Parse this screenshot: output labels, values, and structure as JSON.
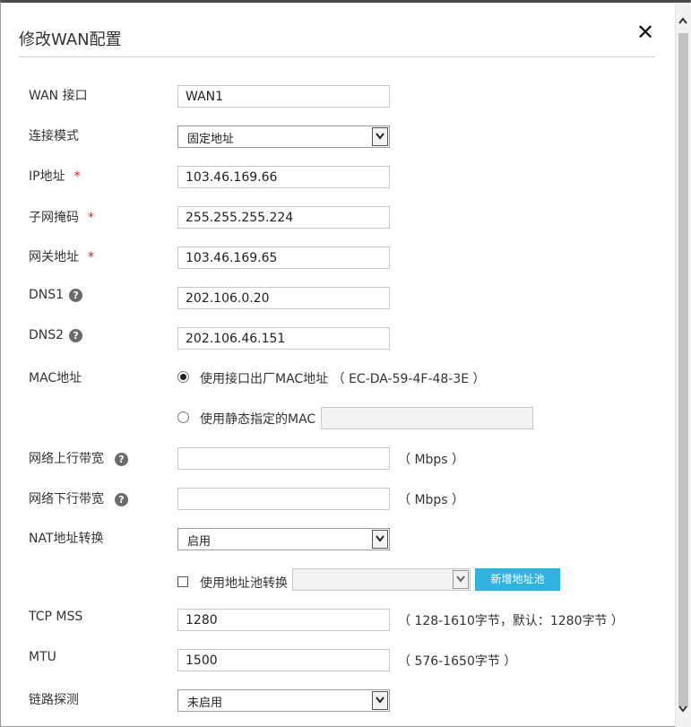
{
  "dialog": {
    "title": "修改WAN配置",
    "close_symbol": "✕"
  },
  "colors": {
    "accent": "#2eb4de",
    "required": "#e02020",
    "help_icon": "#6b6b6b",
    "border": "#c8c8c8"
  },
  "icons": {
    "close": "close-icon",
    "help": "help-icon",
    "dropdown": "chevron-down-icon"
  },
  "form": {
    "wan_port": {
      "label": "WAN 接口",
      "value": "WAN1"
    },
    "connection_mode": {
      "label": "连接模式",
      "value": "固定地址"
    },
    "ip_address": {
      "label": "IP地址",
      "required_mark": "*",
      "value": "103.46.169.66"
    },
    "subnet_mask": {
      "label": "子网掩码",
      "required_mark": "*",
      "value": "255.255.255.224"
    },
    "gateway": {
      "label": "网关地址",
      "required_mark": "*",
      "value": "103.46.169.65"
    },
    "dns1": {
      "label": "DNS1",
      "help": "?",
      "value": "202.106.0.20"
    },
    "dns2": {
      "label": "DNS2",
      "help": "?",
      "value": "202.106.46.151"
    },
    "mac": {
      "label": "MAC地址",
      "option_factory": "使用接口出厂MAC地址 （ EC-DA-59-4F-48-3E ）",
      "option_static": "使用静态指定的MAC",
      "static_value": "",
      "selected": "factory"
    },
    "uplink_bandwidth": {
      "label": "网络上行带宽",
      "help": "?",
      "value": "",
      "unit": "（ Mbps ）"
    },
    "downlink_bandwidth": {
      "label": "网络下行带宽",
      "help": "?",
      "value": "",
      "unit": "（ Mbps ）"
    },
    "nat": {
      "label": "NAT地址转换",
      "value": "启用",
      "pool_checkbox_label": "使用地址池转换",
      "pool_checked": false,
      "pool_value": "",
      "add_pool_button": "新增地址池"
    },
    "tcp_mss": {
      "label": "TCP MSS",
      "value": "1280",
      "hint": "（ 128-1610字节，默认：1280字节 ）"
    },
    "mtu": {
      "label": "MTU",
      "value": "1500",
      "hint": "（ 576-1650字节 ）"
    },
    "link_detection": {
      "label": "链路探测",
      "value": "未启用"
    }
  }
}
